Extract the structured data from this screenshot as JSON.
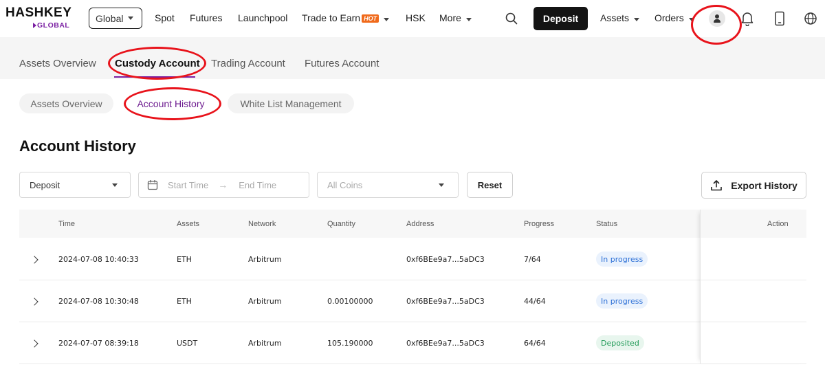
{
  "brand": {
    "word": "HASHKEY",
    "sub": "GLOBAL"
  },
  "topnav": {
    "region": "Global",
    "items": [
      "Spot",
      "Futures",
      "Launchpool",
      "Trade to Earn",
      "HSK",
      "More"
    ],
    "hot_badge": "HOT",
    "deposit_label": "Deposit",
    "assets_label": "Assets",
    "orders_label": "Orders"
  },
  "account_tabs": [
    "Assets Overview",
    "Custody Account",
    "Trading Account",
    "Futures Account"
  ],
  "sub_tabs": [
    "Assets Overview",
    "Account History",
    "White List Management"
  ],
  "page_title": "Account History",
  "filters": {
    "type_value": "Deposit",
    "start_placeholder": "Start Time",
    "end_placeholder": "End Time",
    "coin_placeholder": "All Coins",
    "reset_label": "Reset",
    "export_label": "Export History"
  },
  "table": {
    "headers": [
      "Time",
      "Assets",
      "Network",
      "Quantity",
      "Address",
      "Progress",
      "Status",
      "Action"
    ],
    "rows": [
      {
        "time": "2024-07-08 10:40:33",
        "asset": "ETH",
        "network": "Arbitrum",
        "quantity": "",
        "address": "0xf6BEe9a7...5aDC3",
        "progress": "7/64",
        "status": "In progress"
      },
      {
        "time": "2024-07-08 10:30:48",
        "asset": "ETH",
        "network": "Arbitrum",
        "quantity": "0.00100000",
        "address": "0xf6BEe9a7...5aDC3",
        "progress": "44/64",
        "status": "In progress"
      },
      {
        "time": "2024-07-07 08:39:18",
        "asset": "USDT",
        "network": "Arbitrum",
        "quantity": "105.190000",
        "address": "0xf6BEe9a7...5aDC3",
        "progress": "64/64",
        "status": "Deposited"
      }
    ]
  },
  "colors": {
    "accent": "#7a1fa2",
    "annotation": "#e8131b",
    "hot": "#f06a1b"
  }
}
